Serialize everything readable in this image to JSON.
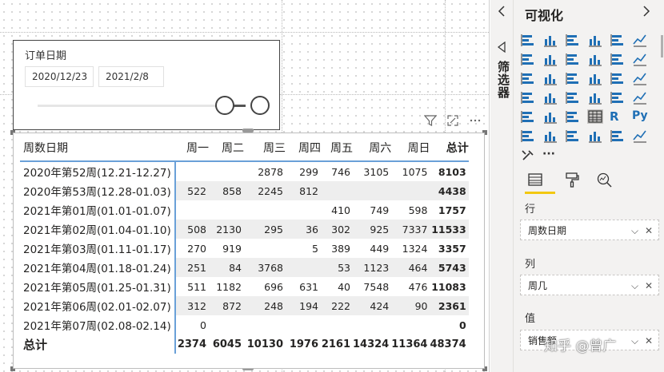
{
  "slicer": {
    "title": "订单日期",
    "start_date": "2020/12/23",
    "end_date": "2021/2/8"
  },
  "matrix": {
    "columns": [
      "周数日期",
      "周一",
      "周二",
      "周三",
      "周四",
      "周五",
      "周六",
      "周日",
      "总计"
    ],
    "rows": [
      {
        "label": "2020年第52周(12.21-12.27)",
        "values": [
          "",
          "",
          "2878",
          "299",
          "746",
          "3105",
          "1075",
          "8103"
        ]
      },
      {
        "label": "2020年第53周(12.28-01.03)",
        "values": [
          "522",
          "858",
          "2245",
          "812",
          "",
          "",
          "",
          "4438"
        ]
      },
      {
        "label": "2021年第01周(01.01-01.07)",
        "values": [
          "",
          "",
          "",
          "",
          "410",
          "749",
          "598",
          "1757"
        ]
      },
      {
        "label": "2021年第02周(01.04-01.10)",
        "values": [
          "508",
          "2130",
          "295",
          "36",
          "302",
          "925",
          "7337",
          "11533"
        ]
      },
      {
        "label": "2021年第03周(01.11-01.17)",
        "values": [
          "270",
          "919",
          "",
          "5",
          "389",
          "449",
          "1324",
          "3357"
        ]
      },
      {
        "label": "2021年第04周(01.18-01.24)",
        "values": [
          "251",
          "84",
          "3768",
          "",
          "53",
          "1123",
          "464",
          "5743"
        ]
      },
      {
        "label": "2021年第05周(01.25-01.31)",
        "values": [
          "511",
          "1182",
          "696",
          "631",
          "40",
          "7548",
          "476",
          "11083"
        ]
      },
      {
        "label": "2021年第06周(02.01-02.07)",
        "values": [
          "312",
          "872",
          "248",
          "194",
          "222",
          "424",
          "90",
          "2361"
        ]
      },
      {
        "label": "2021年第07周(02.08-02.14)",
        "values": [
          "0",
          "",
          "",
          "",
          "",
          "",
          "",
          "0"
        ]
      }
    ],
    "total_row": {
      "label": "总计",
      "values": [
        "2374",
        "6045",
        "10130",
        "1976",
        "2161",
        "14324",
        "11364",
        "48374"
      ]
    }
  },
  "filter_rail": {
    "label": "筛选器"
  },
  "viz_pane": {
    "title": "可视化",
    "sections": {
      "rows_label": "行",
      "rows_field": "周数日期",
      "cols_label": "列",
      "cols_field": "周几",
      "values_label": "值",
      "values_field": "销售额"
    },
    "more": "···",
    "python_label": "Py",
    "r_label": "R"
  },
  "watermark": "知乎 @曾广",
  "colors": {
    "accent": "#f2c811",
    "divider": "#6aa0d8",
    "band": "#eeeeee"
  }
}
